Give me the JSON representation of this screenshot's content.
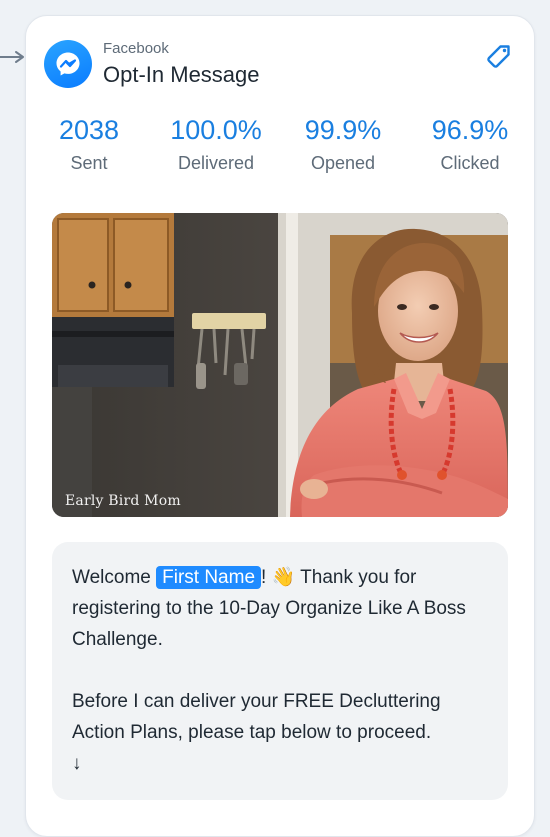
{
  "header": {
    "channel": "Facebook",
    "message_name": "Opt-In Message",
    "channel_icon": "messenger-icon",
    "tag_icon": "tag-icon"
  },
  "stats": [
    {
      "value": "2038",
      "label": "Sent"
    },
    {
      "value": "100.0%",
      "label": "Delivered"
    },
    {
      "value": "99.9%",
      "label": "Opened"
    },
    {
      "value": "96.9%",
      "label": "Clicked"
    }
  ],
  "image": {
    "watermark": "Early Bird Mom"
  },
  "message": {
    "greeting": "Welcome",
    "personalization": "First Name",
    "after_tag": "! 👋 Thank you for registering to the 10-Day Organize Like A Boss Challenge.",
    "paragraph2": "Before I can deliver your FREE Decluttering Action Plans, please tap below to proceed.",
    "arrow": "↓"
  },
  "colors": {
    "accent": "#1a7fe0",
    "tag_bg": "#1f8bff",
    "messenger_blue": "#0a7cff",
    "bubble_bg": "#f1f3f5"
  }
}
